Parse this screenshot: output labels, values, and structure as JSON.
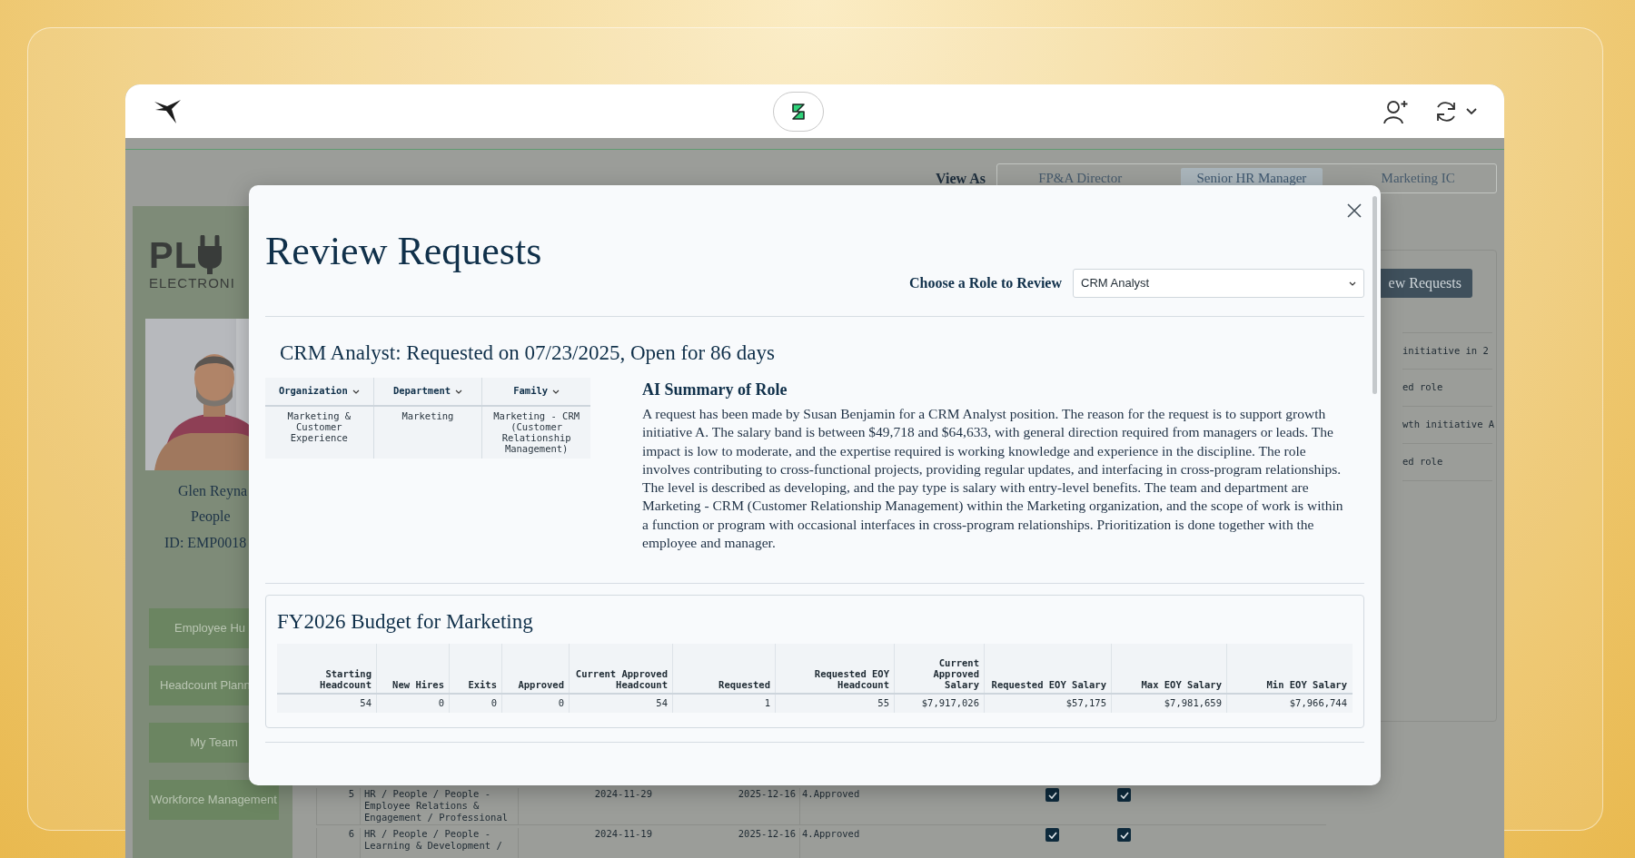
{
  "view_as": {
    "label": "View As",
    "tabs": [
      {
        "label": "FP&A Director",
        "selected": false
      },
      {
        "label": "Senior HR Manager",
        "selected": true
      },
      {
        "label": "Marketing IC",
        "selected": false
      }
    ]
  },
  "sidebar": {
    "logo_text": [
      "PL"
    ],
    "logo_subtitle": "ELECTRONI",
    "profile": {
      "name": "Glen Reyna",
      "department": "People",
      "employee_id": "ID: EMP0018"
    },
    "nav": [
      {
        "label": "Employee Hu"
      },
      {
        "label": "Headcount Plann"
      },
      {
        "label": "My Team"
      },
      {
        "label": "Workforce Management"
      }
    ]
  },
  "background": {
    "action_button": "ew Requests",
    "notes": [
      "initiative in 2",
      "ed role",
      "wth initiative A",
      "ed role"
    ],
    "rows": [
      {
        "number": "5",
        "path": "HR / People / People - Employee Relations & Engagement / Professional",
        "start": "2024-11-29",
        "end": "2025-12-16",
        "status": "4.Approved",
        "checks": [
          {
            "checked": true
          },
          {
            "checked": true
          }
        ]
      },
      {
        "number": "6",
        "path": "HR / People / People - Learning & Development /",
        "start": "2024-11-19",
        "end": "2025-12-16",
        "status": "4.Approved",
        "checks": [
          {
            "checked": true
          },
          {
            "checked": true
          }
        ]
      }
    ]
  },
  "modal": {
    "title": "Review Requests",
    "role_picker": {
      "label": "Choose a Role to Review",
      "value": "CRM Analyst"
    },
    "request_title": "CRM Analyst: Requested on 07/23/2025, Open for 86 days",
    "role_table": {
      "columns": [
        "Organization",
        "Department",
        "Family"
      ],
      "row": [
        "Marketing & Customer Experience",
        "Marketing",
        "Marketing - CRM (Customer Relationship Management)"
      ]
    },
    "summary": {
      "heading": "AI Summary of Role",
      "text": "A request has been made by Susan Benjamin for a CRM Analyst position. The reason for the request is to support growth initiative A. The salary band is between $49,718 and $64,633, with general direction required from managers or leads. The impact is low to moderate, and the expertise required is working knowledge and experience in the discipline. The role involves contributing to cross-functional projects, providing regular updates, and interfacing in cross-program relationships. The level is described as developing, and the pay type is salary with entry-level benefits. The team and department are Marketing - CRM (Customer Relationship Management) within the Marketing organization, and the scope of work is within a function or program with occasional interfaces in cross-program relationships. Prioritization is done together with the employee and manager."
    },
    "budget": {
      "title": "FY2026 Budget for Marketing",
      "columns": [
        "Starting Headcount",
        "New Hires",
        "Exits",
        "Approved",
        "Current Approved Headcount",
        "Requested",
        "Requested EOY Headcount",
        "Current Approved Salary",
        "Requested EOY Salary",
        "Max EOY Salary",
        "Min EOY Salary"
      ],
      "row": [
        "54",
        "0",
        "0",
        "0",
        "54",
        "1",
        "55",
        "$7,917,026",
        "$57,175",
        "$7,981,659",
        "$7,966,744"
      ]
    }
  }
}
